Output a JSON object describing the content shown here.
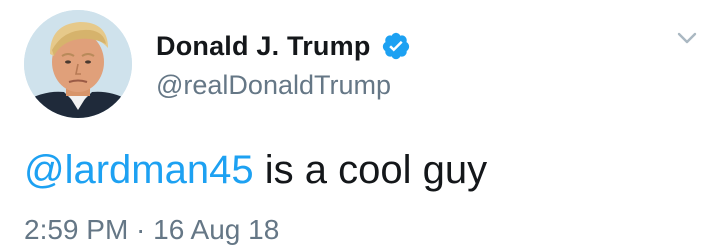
{
  "author": {
    "display_name": "Donald J. Trump",
    "handle": "@realDonaldTrump",
    "verified": true,
    "avatar_icon": "profile-photo",
    "verified_icon": "verified-badge-icon",
    "verified_color": "#1da1f2"
  },
  "menu": {
    "icon": "chevron-down-icon"
  },
  "tweet": {
    "mention": "@lardman45",
    "text_rest": " is a cool guy",
    "mention_color": "#1da1f2"
  },
  "meta": {
    "timestamp": "2:59 PM · 16 Aug 18"
  }
}
